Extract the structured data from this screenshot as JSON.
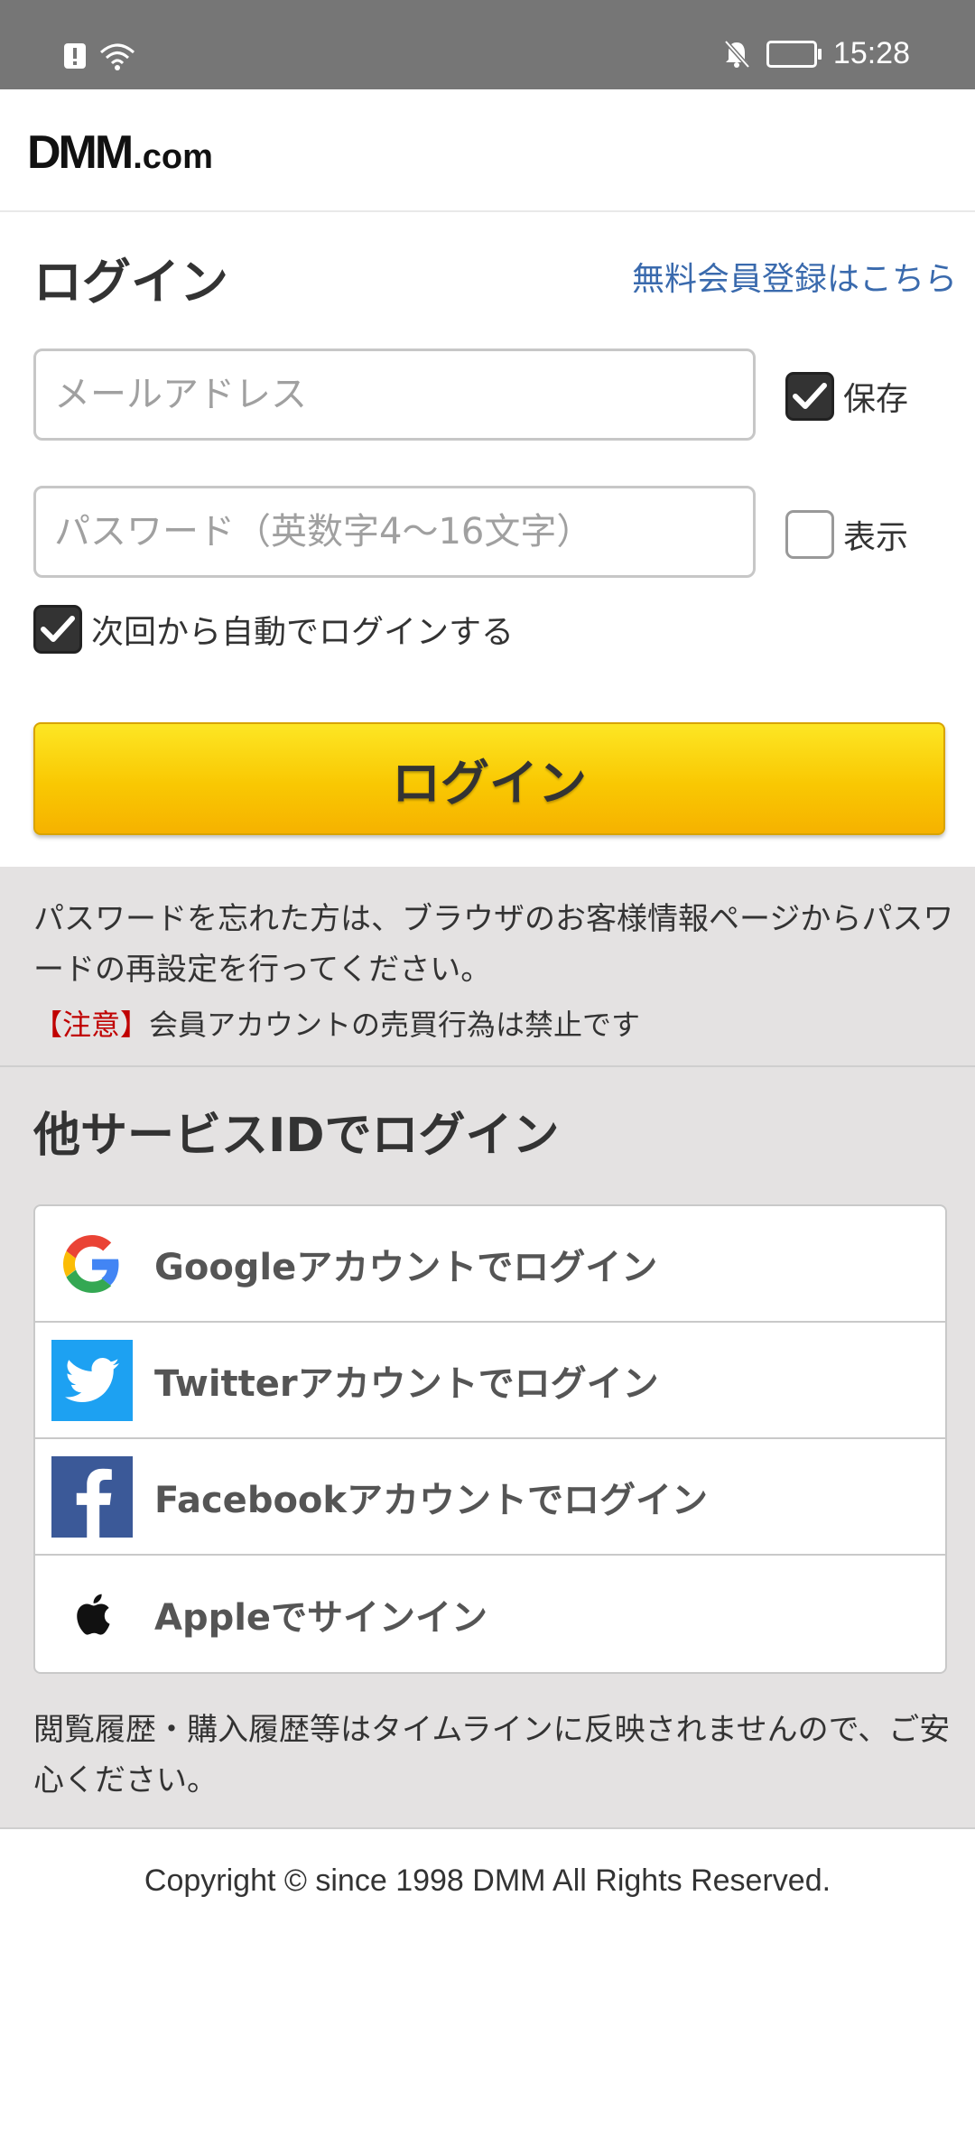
{
  "status_bar": {
    "time": "15:28"
  },
  "header": {
    "logo_main": "DMM",
    "logo_suffix": ".com"
  },
  "login": {
    "title": "ログイン",
    "register_link": "無料会員登録はこちら",
    "email_placeholder": "メールアドレス",
    "password_placeholder": "パスワード（英数字4〜16文字）",
    "save_label": "保存",
    "save_checked": true,
    "show_label": "表示",
    "show_checked": false,
    "auto_login_label": "次回から自動でログインする",
    "auto_login_checked": true,
    "button_label": "ログイン"
  },
  "info": {
    "password_notice": "パスワードを忘れた方は、ブラウザのお客様情報ページからパスワードの再設定を行ってください。",
    "caution_tag": "【注意】",
    "caution_text": "会員アカウントの売買行為は禁止です"
  },
  "other_services": {
    "title": "他サービスIDでログイン",
    "items": [
      {
        "label": "Googleアカウントでログイン",
        "icon": "google-icon"
      },
      {
        "label": "Twitterアカウントでログイン",
        "icon": "twitter-icon"
      },
      {
        "label": "Facebookアカウントでログイン",
        "icon": "facebook-icon"
      },
      {
        "label": "Appleでサインイン",
        "icon": "apple-icon"
      }
    ],
    "history_note": "閲覧履歴・購入履歴等はタイムラインに反映されませんので、ご安心ください。"
  },
  "footer": {
    "copyright": "Copyright © since 1998 DMM All Rights Reserved."
  },
  "colors": {
    "status_bar": "#767676",
    "link": "#3a6aad",
    "button_top": "#fde624",
    "button_bottom": "#f6b200",
    "grey_bg": "#e4e2e2",
    "caution_red": "#c00000",
    "twitter": "#1da1f2",
    "facebook": "#3b5998"
  }
}
